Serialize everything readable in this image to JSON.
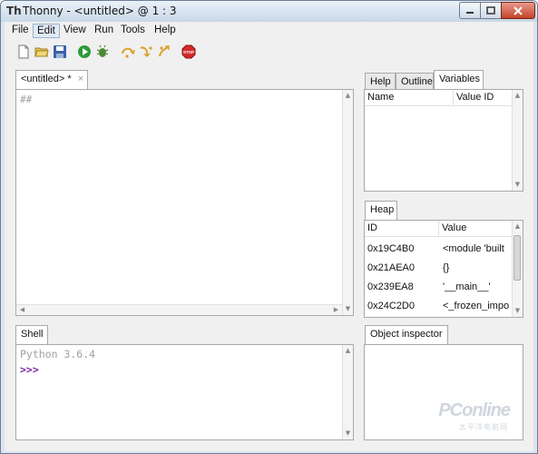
{
  "window": {
    "title": "Thonny  -  <untitled>  @  1 : 3",
    "app_icon_glyph": "Th"
  },
  "menu": [
    "File",
    "Edit",
    "View",
    "Run",
    "Tools",
    "Help"
  ],
  "toolbar": {
    "icons": [
      "new-file-icon",
      "open-folder-icon",
      "save-icon",
      "run-icon",
      "debug-icon",
      "step-over-icon",
      "step-into-icon",
      "step-out-icon",
      "stop-icon"
    ]
  },
  "editor": {
    "tab_label": "<untitled>  *",
    "tab_close": "×",
    "content": "##"
  },
  "shell": {
    "tab_label": "Shell",
    "banner": "Python 3.6.4",
    "prompt": ">>>"
  },
  "side_tabs": {
    "help": "Help",
    "outline": "Outline",
    "variables": "Variables"
  },
  "variables": {
    "col_name": "Name",
    "col_value": "Value ID"
  },
  "heap": {
    "tab_label": "Heap",
    "col_id": "ID",
    "col_value": "Value",
    "rows": [
      {
        "id": "0x19C4B0",
        "value": "<module 'built"
      },
      {
        "id": "0x21AEA0",
        "value": "{}"
      },
      {
        "id": "0x239EA8",
        "value": "'__main__'"
      },
      {
        "id": "0x24C2D0",
        "value": "<_frozen_impo"
      }
    ]
  },
  "object_inspector": {
    "tab_label": "Object inspector"
  },
  "watermark": {
    "brand": "PConline",
    "sub": "太平洋电脑网"
  },
  "colors": {
    "shell_banner": "#a0a0a0",
    "shell_prompt": "#7a1fa2",
    "title_bar": "#c9d8e8"
  }
}
